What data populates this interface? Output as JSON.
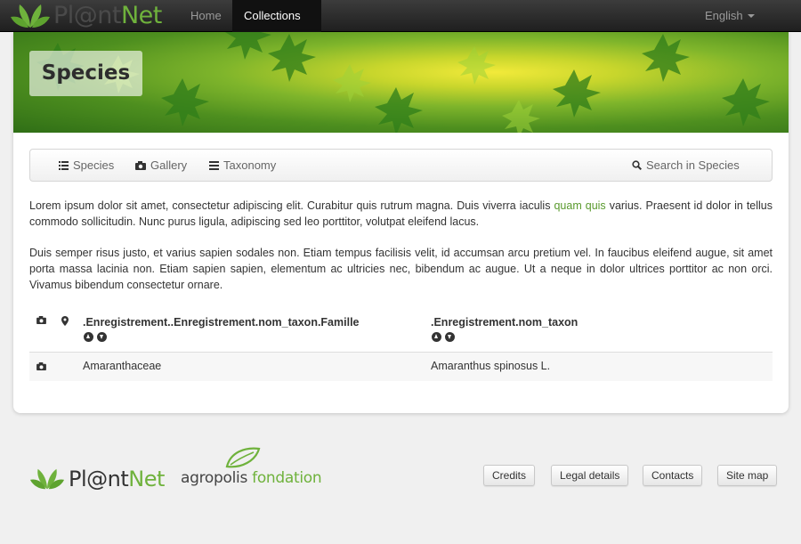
{
  "navbar": {
    "brand_part1": "Pl@nt",
    "brand_part2": "Net",
    "home": "Home",
    "collections": "Collections",
    "language": "English"
  },
  "header": {
    "title": "Species"
  },
  "subnav": {
    "items": [
      {
        "label": "Species",
        "icon": "list-icon"
      },
      {
        "label": "Gallery",
        "icon": "camera-icon"
      },
      {
        "label": "Taxonomy",
        "icon": "tree-list-icon"
      }
    ],
    "search": "Search in Species"
  },
  "content": {
    "para1_before": "Lorem ipsum dolor sit amet, consectetur adipiscing elit. Curabitur quis rutrum magna. Duis viverra iaculis ",
    "para1_link": "quam quis",
    "para1_after": " varius. Praesent id dolor in tellus commodo sollicitudin. Nunc purus ligula, adipiscing sed leo porttitor, volutpat eleifend lacus.",
    "para2": "Duis semper risus justo, et varius sapien sodales non. Etiam tempus facilisis velit, id accumsan arcu pretium vel. In faucibus eleifend augue, sit amet porta massa lacinia non. Etiam sapien sapien, elementum ac ultricies nec, bibendum ac augue. Ut a neque in dolor ultrices porttitor ac non orci. Vivamus bibendum consectetur ornare."
  },
  "table": {
    "columns": [
      ".Enregistrement..Enregistrement.nom_taxon.Famille",
      ".Enregistrement.nom_taxon"
    ],
    "rows": [
      {
        "famille": "Amaranthaceae",
        "taxon": "Amaranthus spinosus L."
      }
    ]
  },
  "footer": {
    "brand_part1": "Pl@nt",
    "brand_part2": "Net",
    "agro_part1": "agropolis",
    "agro_part2": " fondation",
    "buttons": [
      "Credits",
      "Legal details",
      "Contacts",
      "Site map"
    ]
  },
  "colors": {
    "brand_green": "#6fb23c",
    "link_green": "#5a9a2e",
    "navbar_dark": "#2b2b2b"
  }
}
